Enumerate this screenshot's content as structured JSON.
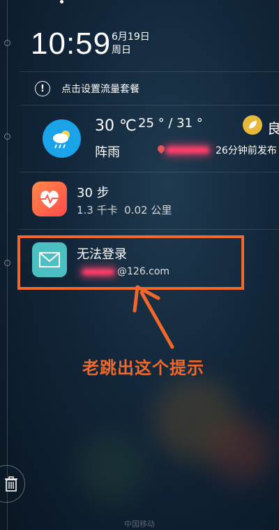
{
  "status": {
    "time": "10:59",
    "date": "6月19日",
    "weekday": "周日"
  },
  "data_plan": {
    "text": "点击设置流量套餐"
  },
  "weather": {
    "temp": "30 ℃",
    "range": "25 ° / 31 °",
    "condition": "阵雨",
    "aqi": "良",
    "published": "26分钟前发布",
    "icon_color": "#1aa3e8"
  },
  "health": {
    "steps": "30 步",
    "calories": "1.3 千卡",
    "distance": "0.02 公里"
  },
  "mail": {
    "title": "无法登录",
    "address": "@126.com",
    "icon_color": "#4bbfc1"
  },
  "annotation": {
    "text": "老跳出这个提示",
    "color": "#f0682a"
  },
  "carrier": {
    "name": "中国移动"
  },
  "icons": [
    "info-icon",
    "weather-icon",
    "location-icon",
    "leaf-icon",
    "health-icon",
    "mail-icon",
    "trash-icon",
    "arrow-icon"
  ]
}
